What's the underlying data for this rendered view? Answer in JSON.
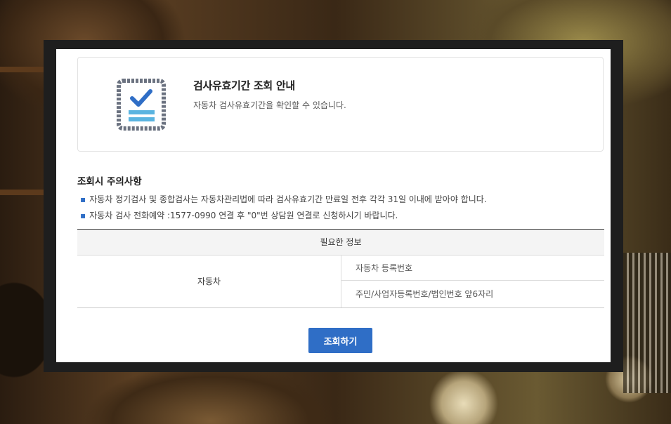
{
  "info": {
    "title": "검사유효기간 조회 안내",
    "subtitle": "자동차 검사유효기간을 확인할 수 있습니다.",
    "icon": "checklist-icon"
  },
  "notice": {
    "title": "조회시 주의사항",
    "items": [
      "자동차 정기검사 및 종합검사는 자동차관리법에 따라 검사유효기간 만료일 전후 각각 31일 이내에 받아야 합니다.",
      "자동차 검사 전화예약 :1577-0990 연결 후 \"0\"번 상담원 연결로 신청하시기 바랍니다."
    ]
  },
  "required_info": {
    "header": "필요한 정보",
    "category": "자동차",
    "items": [
      "자동차 등록번호",
      "주민/사업자등록번호/법인번호 앞6자리"
    ]
  },
  "actions": {
    "submit_label": "조회하기"
  },
  "colors": {
    "accent": "#2f6ec6",
    "icon_frame": "#6b7280",
    "icon_check": "#2f6ec6",
    "icon_lines": "#5ab4e0"
  }
}
